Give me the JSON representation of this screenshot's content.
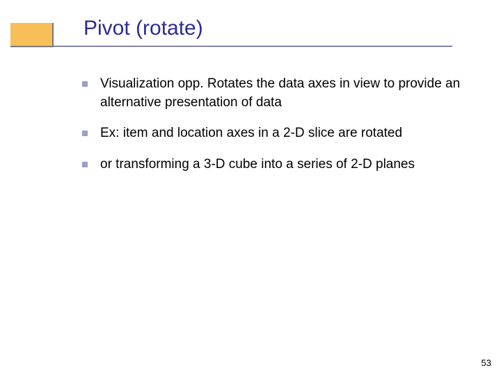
{
  "slide": {
    "title": "Pivot (rotate)",
    "bullets": [
      "Visualization opp. Rotates the data axes in view to provide an alternative presentation of data",
      "Ex: item and location axes in a 2-D slice are rotated",
      "or transforming a 3-D cube into a series of 2-D planes"
    ],
    "page_number": "53"
  }
}
